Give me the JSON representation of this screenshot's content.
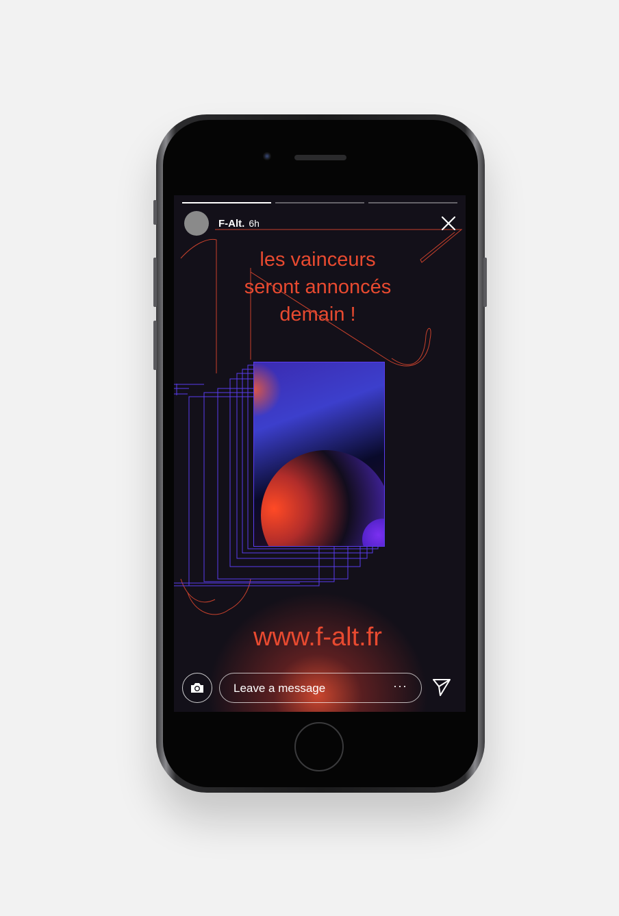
{
  "story": {
    "username": "F-Alt.",
    "time_ago": "6h",
    "headline_lines": [
      "les vainceurs",
      "seront annoncés",
      "demain !"
    ],
    "url": "www.f-alt.fr",
    "progress_segments": 3,
    "active_segment": 1
  },
  "reply_bar": {
    "placeholder": "Leave a message",
    "more_label": "···"
  },
  "colors": {
    "accent": "#e84a30",
    "screen_bg": "#131019",
    "violet": "#5a3cf0"
  },
  "icons": [
    "close-icon",
    "camera-icon",
    "send-icon",
    "more-icon"
  ]
}
